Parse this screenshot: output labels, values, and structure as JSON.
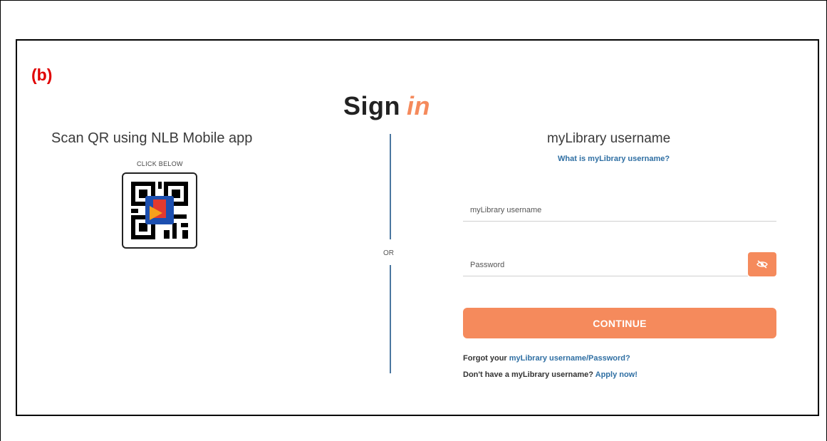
{
  "panel_label": "(b)",
  "title": {
    "word1": "Sign",
    "word2": "in"
  },
  "qr": {
    "heading": "Scan QR using NLB Mobile app",
    "caption": "CLICK BELOW",
    "icon": "qr-code-icon"
  },
  "divider": {
    "or_label": "OR"
  },
  "login": {
    "heading": "myLibrary username",
    "help_link": "What is myLibrary username?",
    "username_placeholder": "myLibrary username",
    "password_placeholder": "Password",
    "password_toggle_icon": "eye-slash-icon",
    "continue_label": "CONTINUE",
    "forgot_prefix": "Forgot your",
    "forgot_link": "myLibrary username/Password?",
    "apply_prefix": "Don't have a myLibrary username?",
    "apply_link": "Apply now!"
  },
  "colors": {
    "accent": "#f58a5c",
    "link": "#2f6fa3",
    "divider": "#4b77a0",
    "label_red": "#e00000"
  }
}
